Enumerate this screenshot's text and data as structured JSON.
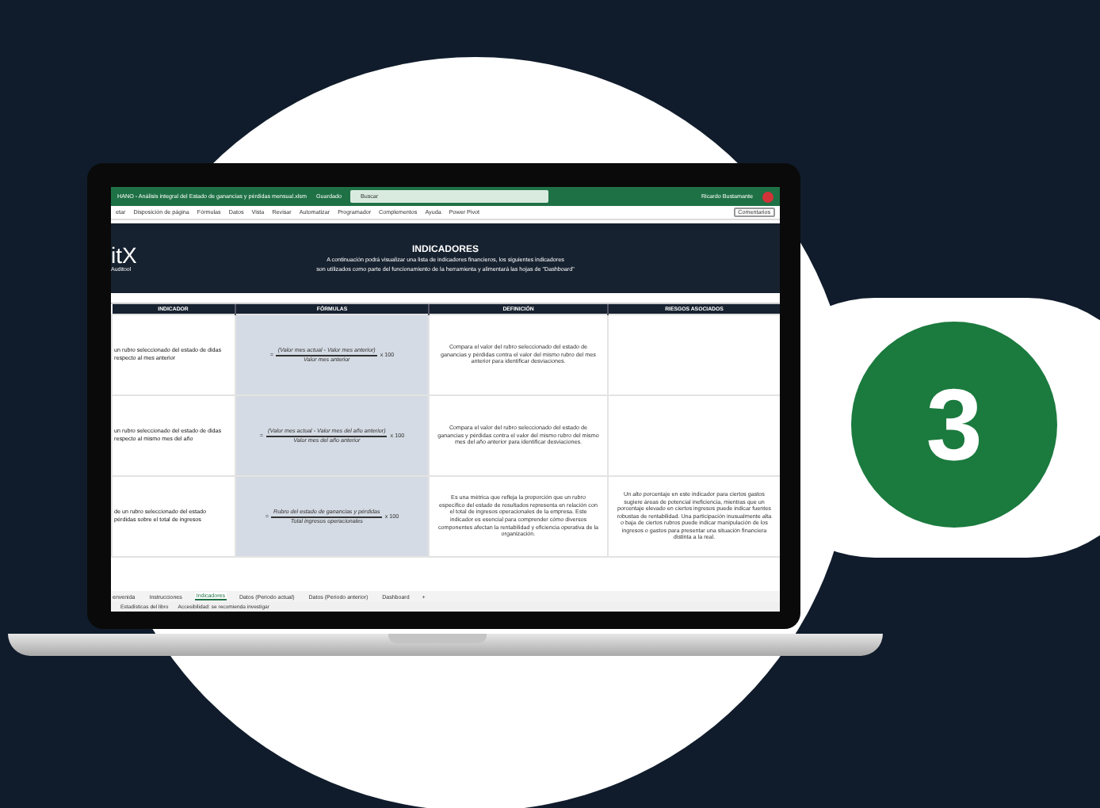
{
  "badge": {
    "number": "3"
  },
  "excel": {
    "title": "HANO - Análisis integral del Estado de ganancias y pérdidas mensual.xlsm",
    "saved": "Guardado",
    "search_placeholder": "Buscar",
    "user": "Ricardo Bustamante",
    "ribbon": [
      "etar",
      "Disposición de página",
      "Fórmulas",
      "Datos",
      "Vista",
      "Revisar",
      "Automatizar",
      "Programador",
      "Complementos",
      "Ayuda",
      "Power Pivot"
    ],
    "comments": "Comentarios"
  },
  "sheet": {
    "logo": "itX",
    "logo_sub": "Auditool",
    "heading": "INDICADORES",
    "intro": [
      "A continuación podrá visualizar una lista de indicadores financieros, los siguientes indicadores",
      "son utilizados como parte del funcionamiento de la herramienta y alimentará las hojas de \"Dashboard\""
    ],
    "columns": [
      "INDICADOR",
      "FÓRMULAS",
      "DEFINICIÓN",
      "RIESGOS ASOCIADOS"
    ],
    "rows": [
      {
        "indicator": "un rubro seleccionado del estado de didas respecto al mes anterior",
        "numerator": "(Valor mes actual - Valor mes anterior)",
        "denominator": "Valor mes anterior",
        "eq": "=",
        "times": "x 100",
        "definition": "Compara el valor del rubro seleccionado del estado de ganancias y pérdidas contra el valor del mismo rubro del mes anterior para identificar desviaciones.",
        "risks": ""
      },
      {
        "indicator": "un rubro seleccionado del estado de didas respecto al mismo mes del año",
        "numerator": "(Valor mes actual - Valor mes del año anterior)",
        "denominator": "Valor mes del año anterior",
        "eq": "=",
        "times": "x 100",
        "definition": "Compara el valor del rubro seleccionado del estado de ganancias y pérdidas contra el valor del mismo rubro del mismo mes del año anterior para identificar desviaciones.",
        "risks": ""
      },
      {
        "indicator": "de un rubro seleccionado del estado pérdidas sobre el total de ingresos",
        "numerator": "Rubro del estado de ganancias y pérdidas",
        "denominator": "Total ingresos operacionales",
        "eq": "=",
        "times": "x 100",
        "definition": "Es una métrica que refleja la proporción que un rubro específico del estado de resultados representa en relación con el total de ingresos operacionales de la empresa. Este indicador es esencial para comprender cómo diversos componentes afectan la rentabilidad y eficiencia operativa de la organización.",
        "risks": "Un alto porcentaje en este indicador para ciertos gastos sugiere áreas de potencial ineficiencia, mientras que un porcentaje elevado en ciertos ingresos puede indicar fuentes robustas de rentabilidad. Una participación inusualmente alta o baja de ciertos rubros puede indicar manipulación de los ingresos o gastos para presentar una situación financiera distinta a la real."
      }
    ]
  },
  "sheet_tabs": [
    {
      "label": "envenida",
      "selected": false
    },
    {
      "label": "Instrucciones",
      "selected": false
    },
    {
      "label": "Indicadores",
      "selected": true
    },
    {
      "label": "Datos (Periodo actual)",
      "selected": false
    },
    {
      "label": "Datos (Periodo anterior)",
      "selected": false
    },
    {
      "label": "Dashboard",
      "selected": false
    }
  ],
  "add_sheet": "+",
  "status_bar": {
    "stats": "Estadísticas del libro",
    "accessibility": "Accesibilidad: se recomienda investigar"
  }
}
